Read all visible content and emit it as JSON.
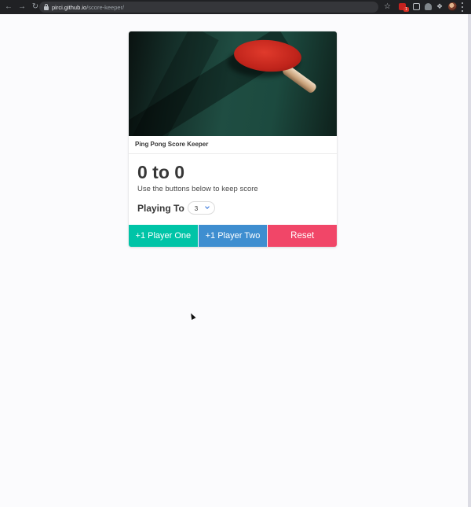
{
  "browser": {
    "url_host": "pirci.github.io",
    "url_path": "/score-keeper/",
    "back_icon": "arrow-left-icon",
    "forward_icon": "arrow-right-icon",
    "reload_icon": "reload-icon",
    "bookmark_icon": "star-icon",
    "extension_badge": "1"
  },
  "card": {
    "image_alt": "ping-pong-paddle-photo",
    "header_title": "Ping Pong Score Keeper",
    "score_text": "0 to 0",
    "subtitle": "Use the buttons below to keep score",
    "playing_to_label": "Playing To",
    "playing_to_value": "3"
  },
  "buttons": {
    "player_one": "+1 Player One",
    "player_two": "+1 Player Two",
    "reset": "Reset"
  },
  "colors": {
    "player_one": "#00c4a7",
    "player_two": "#3e8ed0",
    "reset": "#f14668"
  }
}
